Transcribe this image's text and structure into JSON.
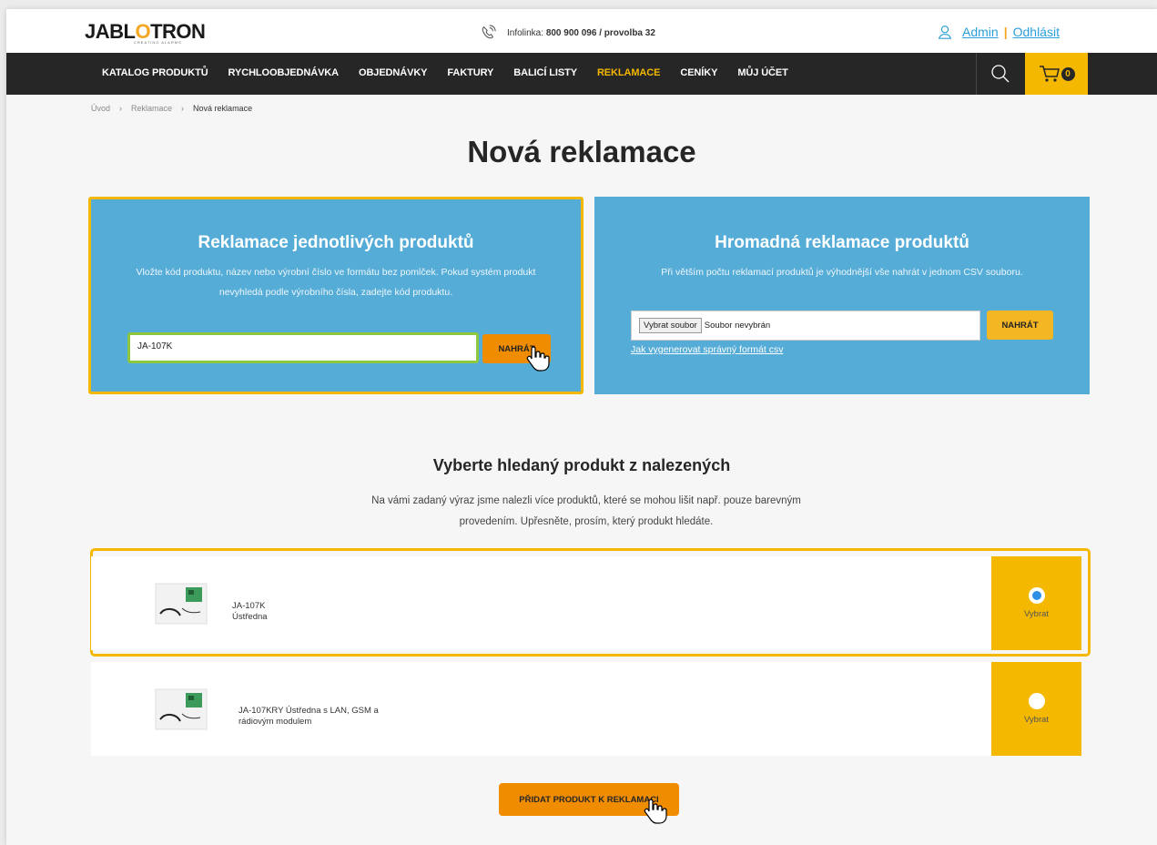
{
  "header": {
    "logo": {
      "main_pre": "JABL",
      "main_o": "O",
      "main_post": "TRON",
      "sub": "CREATING ALARMS"
    },
    "infoline_label": "Infolinka: ",
    "infoline_value": "800 900 096 / provolba 32",
    "user_name": "Admin",
    "logout_label": "Odhlásit",
    "separator": "|"
  },
  "nav": {
    "items": [
      {
        "label": "KATALOG PRODUKTŮ"
      },
      {
        "label": "RYCHLOOBJEDNÁVKA"
      },
      {
        "label": "OBJEDNÁVKY"
      },
      {
        "label": "FAKTURY"
      },
      {
        "label": "BALICÍ LISTY"
      },
      {
        "label": "REKLAMACE",
        "active": true
      },
      {
        "label": "CENÍKY"
      },
      {
        "label": "MŮJ ÚČET"
      }
    ],
    "cart_count": "0",
    "icons": [
      "search-icon",
      "cart-icon"
    ]
  },
  "breadcrumb": {
    "items": [
      "Úvod",
      "Reklamace",
      "Nová reklamace"
    ],
    "separator": "›"
  },
  "page_title": "Nová reklamace",
  "single_panel": {
    "title": "Reklamace jednotlivých produktů",
    "text": "Vložte kód produktu, název nebo výrobní číslo ve formátu bez pomlček. Pokud systém produkt nevyhledá podle výrobního čísla, zadejte kód produktu.",
    "input_value": "JA-107K",
    "button_label": "NAHRÁT"
  },
  "bulk_panel": {
    "title": "Hromadná reklamace produktů",
    "text": "Při větším počtu reklamací produktů je výhodnější vše nahrát v jednom CSV souboru.",
    "file_button": "Vybrat soubor",
    "file_status": "Soubor nevybrán",
    "button_label": "NAHRÁT",
    "csv_link": "Jak vygenerovat správný formát csv"
  },
  "results": {
    "title": "Vyberte hledaný produkt z nalezených",
    "description": "Na vámi zadaný výraz jsme nalezli více produktů, které se mohou lišit např. pouze barevným provedením. Upřesněte, prosím, který produkt hledáte.",
    "products": [
      {
        "code": "JA-107K",
        "name": "Ústředna",
        "select_label": "Vybrat",
        "selected": true
      },
      {
        "line1": "JA-107KRY Ústředna s LAN, GSM a",
        "line2": "rádiovým modulem",
        "select_label": "Vybrat",
        "selected": false
      }
    ],
    "add_button": "PŘIDAT PRODUKT K REKLAMACI"
  },
  "colors": {
    "accent": "#f5b800",
    "panel_blue": "#55acd7",
    "nav_bg": "#262626",
    "button_orange": "#f08c00",
    "input_green": "#8dc63f"
  }
}
